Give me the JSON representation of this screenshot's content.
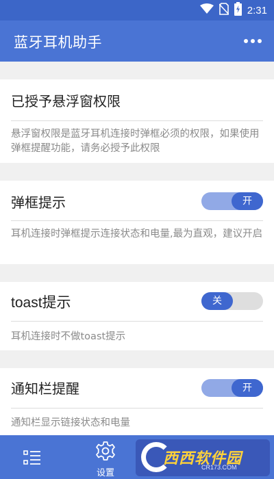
{
  "status_bar": {
    "time": "2:31",
    "icons": [
      "wifi-icon",
      "no-sim-icon",
      "battery-charging-icon"
    ]
  },
  "app_bar": {
    "title": "蓝牙耳机助手",
    "menu_icon": "more-horizontal-icon"
  },
  "sections": [
    {
      "title": "已授予悬浮窗权限",
      "description": "悬浮窗权限是蓝牙耳机连接时弹框必须的权限，如果使用弹框提醒功能，请务必授予此权限"
    },
    {
      "title": "弹框提示",
      "toggle": {
        "state": "on",
        "label": "开"
      },
      "description": "耳机连接时弹框提示连接状态和电量,最为直观，建议开启"
    },
    {
      "title": "toast提示",
      "toggle": {
        "state": "off",
        "label": "关"
      },
      "description": "耳机连接时不做toast提示"
    },
    {
      "title": "通知栏提醒",
      "toggle": {
        "state": "on",
        "label": "开"
      },
      "description": "通知栏显示链接状态和电量"
    }
  ],
  "bottom_nav": {
    "list_icon": "list-icon",
    "settings_icon": "gear-icon",
    "settings_label": "设置"
  },
  "watermark": {
    "text": "西西软件园",
    "sub": "CR173.COM"
  },
  "colors": {
    "primary": "#4a74d4",
    "status_bar": "#3c66c8",
    "toggle_knob": "#3f67cf",
    "toggle_track_on": "#91a9e6",
    "toggle_track_off": "#dedede",
    "background": "#f0f0f0"
  }
}
